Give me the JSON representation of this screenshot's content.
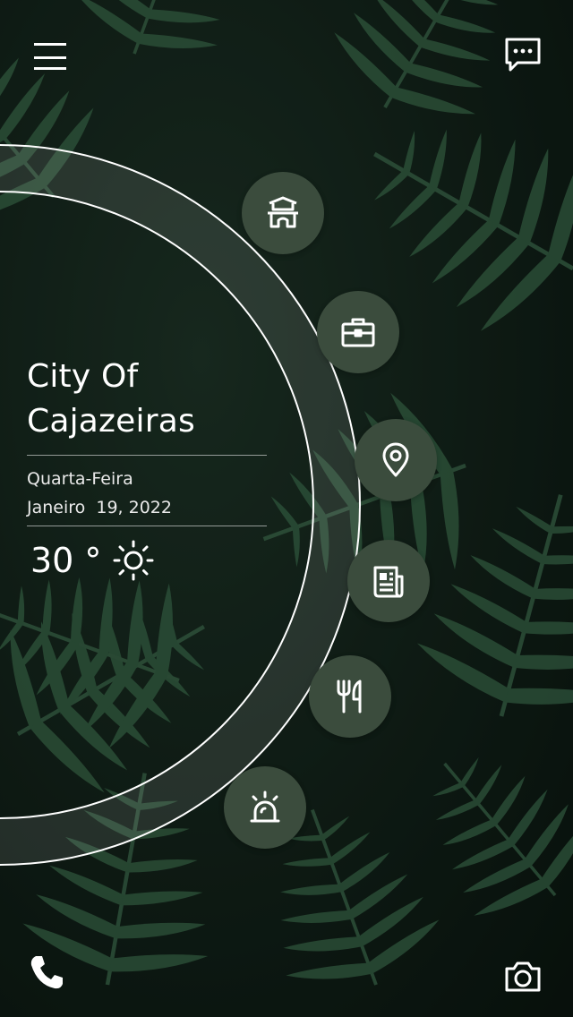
{
  "city": {
    "line1": "City Of",
    "line2": "Cajazeiras"
  },
  "date": {
    "weekday": "Quarta-Feira",
    "full": "Janeiro  19, 2022"
  },
  "weather": {
    "temperature": "30 °",
    "icon": "sun-icon"
  },
  "nav_buttons": [
    {
      "icon": "temple-icon"
    },
    {
      "icon": "briefcase-icon"
    },
    {
      "icon": "location-pin-icon"
    },
    {
      "icon": "newspaper-icon"
    },
    {
      "icon": "fork-knife-icon"
    },
    {
      "icon": "alarm-siren-icon"
    }
  ],
  "top_bar": {
    "left_icon": "hamburger-menu-icon",
    "right_icon": "chat-icon"
  },
  "bottom_bar": {
    "left_icon": "phone-icon",
    "right_icon": "camera-icon"
  },
  "colors": {
    "button_fill": "#3b4c3d",
    "background": "#0f1a14"
  }
}
